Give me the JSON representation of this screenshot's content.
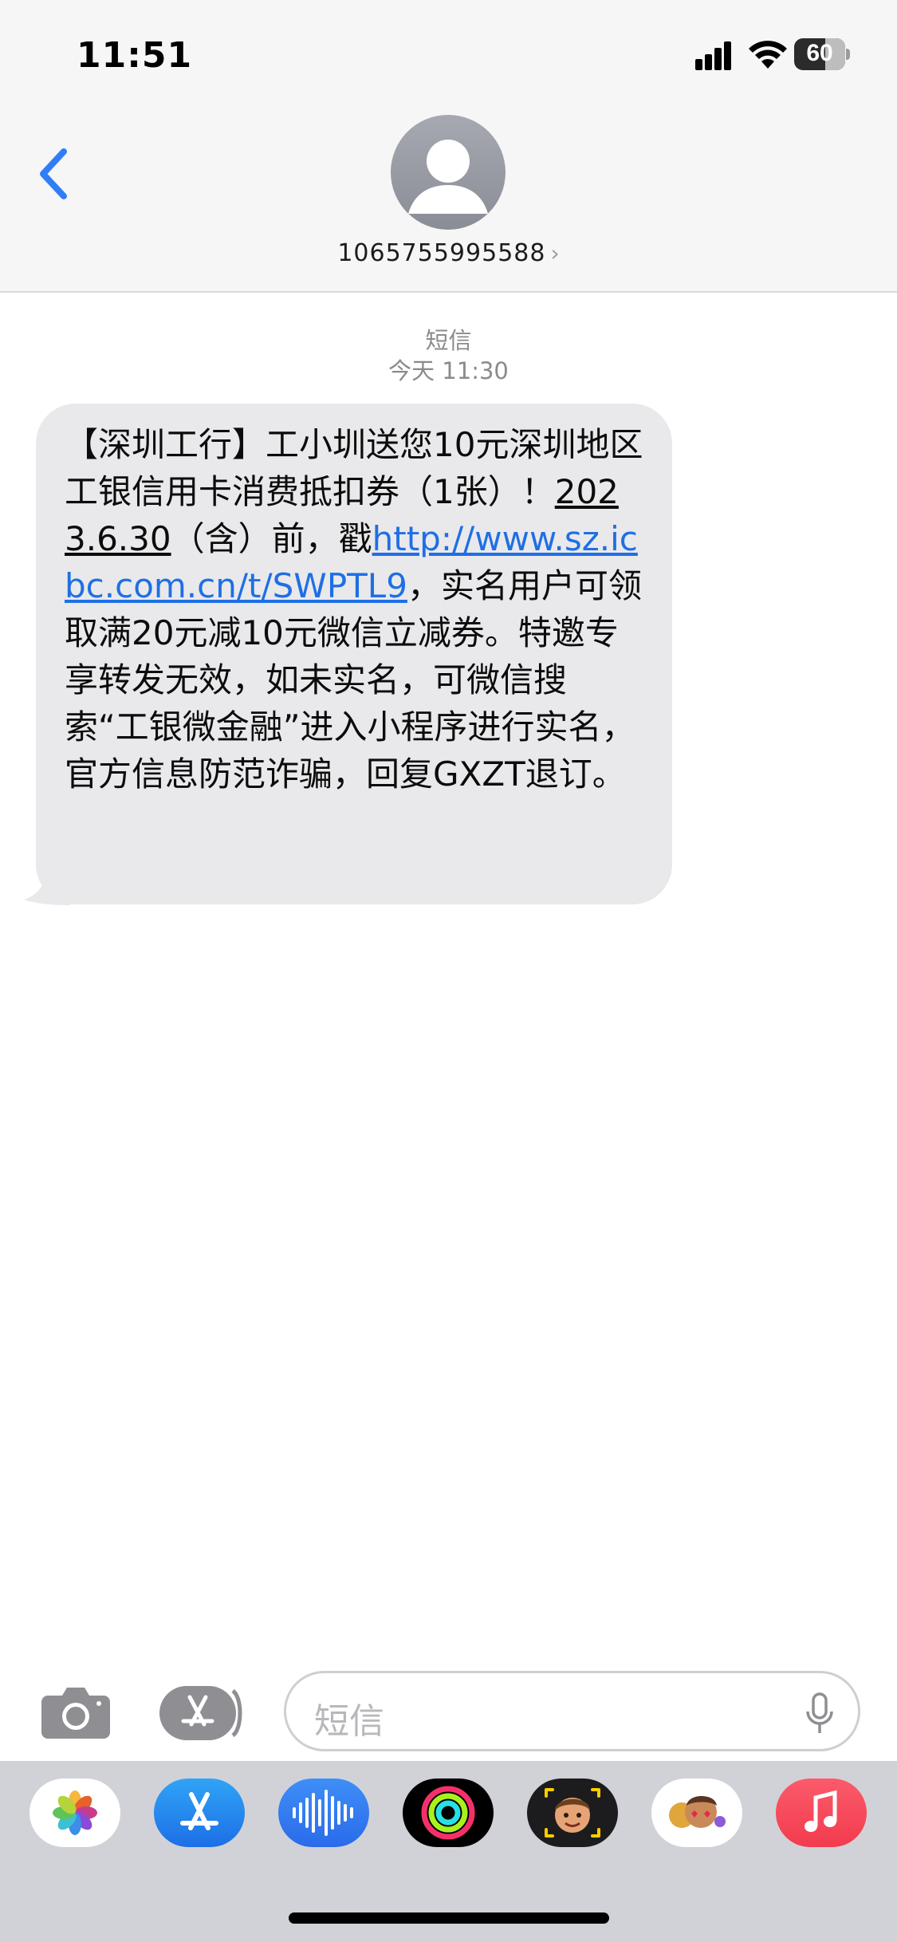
{
  "status_bar": {
    "time": "11:51",
    "battery": "60"
  },
  "header": {
    "contact_number": "1065755995588",
    "chevron": "›"
  },
  "thread": {
    "service_label": "短信",
    "timestamp": "今天 11:30"
  },
  "message": {
    "part1": "【深圳工行】工小圳送您10元深圳地区工银信用卡消费抵扣券（1张）！",
    "date": "2023.6.30",
    "part2": "（含）前，戳",
    "link": "http://www.sz.icbc.com.cn/t/SWPTL9",
    "part3": "，实名用户可领取满20元减10元微信立减券。特邀专享转发无效，如未实名，可微信搜索“工银微金融”进入小程序进行实名，官方信息防范诈骗，回复GXZT退订。"
  },
  "composer": {
    "placeholder": "短信"
  },
  "app_drawer": [
    "photos-icon",
    "app-store-icon",
    "audio-message-icon",
    "activity-icon",
    "memoji-icon",
    "memoji-stickers-icon",
    "music-icon"
  ]
}
